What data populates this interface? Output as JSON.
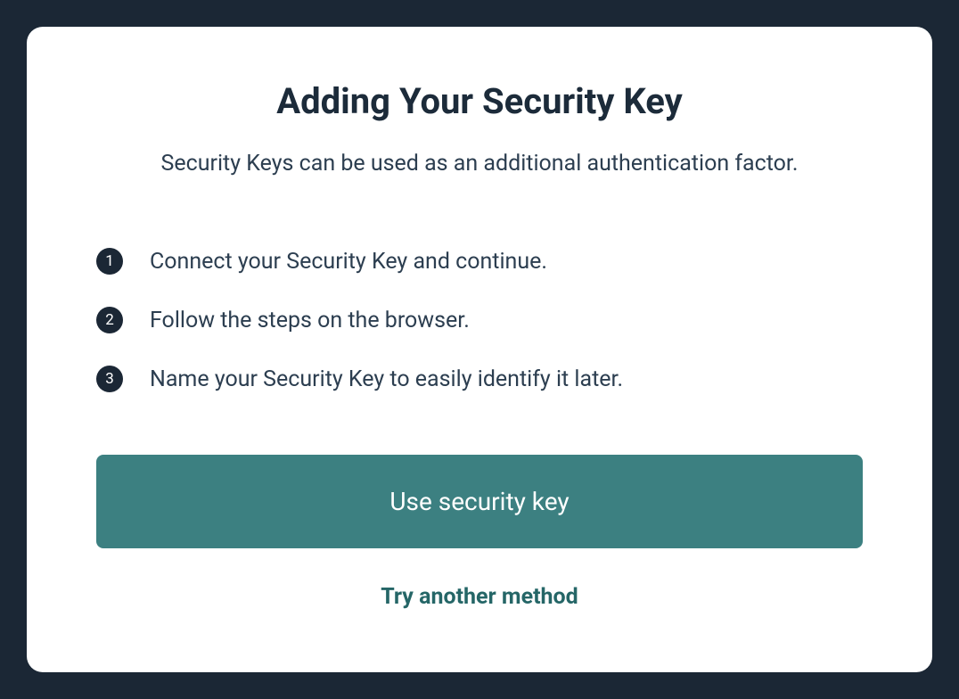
{
  "title": "Adding Your Security Key",
  "subtitle": "Security Keys can be used as an additional authentication factor.",
  "steps": [
    {
      "number": "1",
      "text": "Connect your Security Key and continue."
    },
    {
      "number": "2",
      "text": "Follow the steps on the browser."
    },
    {
      "number": "3",
      "text": "Name your Security Key to easily identify it later."
    }
  ],
  "primary_button_label": "Use security key",
  "secondary_link_label": "Try another method"
}
